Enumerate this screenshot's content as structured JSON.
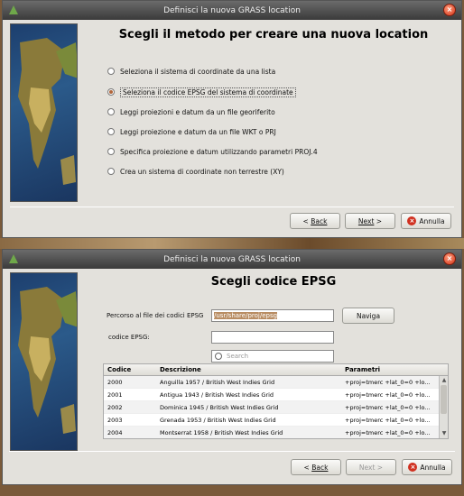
{
  "window1": {
    "title": "Definisci la nuova GRASS location",
    "heading": "Scegli il metodo per creare una nuova location",
    "options": [
      "Seleziona il sistema di coordinate da una lista",
      "Seleziona il codice EPSG del sistema di coordinate",
      "Leggi proiezioni e datum da un file georiferito",
      "Leggi proiezione e datum da un file WKT o PRJ",
      "Specifica proiezione e datum utilizzando parametri PROJ.4",
      "Crea un sistema di coordinate non terrestre (XY)"
    ],
    "selected_index": 1,
    "buttons": {
      "back": "Back",
      "next": "Next",
      "cancel": "Annulla"
    }
  },
  "window2": {
    "title": "Definisci la nuova GRASS location",
    "heading": "Scegli codice EPSG",
    "path_label": "Percorso al file dei codici EPSG",
    "path_value": "/usr/share/proj/epsg",
    "browse": "Naviga",
    "code_label": "codice EPSG:",
    "code_value": "",
    "search_placeholder": "Search",
    "columns": [
      "Codice",
      "Descrizione",
      "Parametri"
    ],
    "rows": [
      [
        "2000",
        "Anguilla 1957 / British West Indies Grid",
        "+proj=tmerc +lat_0=0 +lo..."
      ],
      [
        "2001",
        "Antigua 1943 / British West Indies Grid",
        "+proj=tmerc +lat_0=0 +lo..."
      ],
      [
        "2002",
        "Dominica 1945 / British West Indies Grid",
        "+proj=tmerc +lat_0=0 +lo..."
      ],
      [
        "2003",
        "Grenada 1953 / British West Indies Grid",
        "+proj=tmerc +lat_0=0 +lo..."
      ],
      [
        "2004",
        "Montserrat 1958 / British West Indies Grid",
        "+proj=tmerc +lat_0=0 +lo..."
      ]
    ],
    "buttons": {
      "back": "Back",
      "next": "Next >",
      "cancel": "Annulla"
    }
  },
  "colors": {
    "accent": "#b1663a",
    "selection": "#b88c62",
    "cancel": "#d03020"
  }
}
